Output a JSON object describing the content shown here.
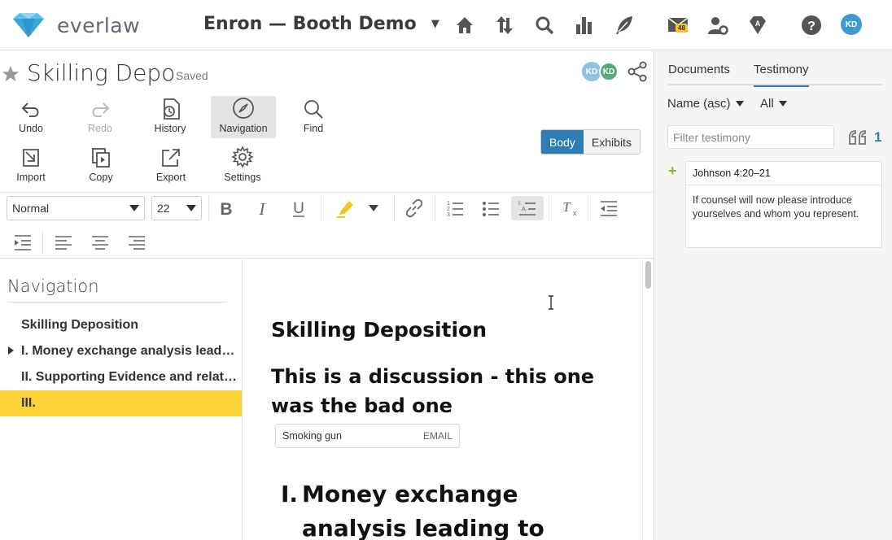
{
  "app": {
    "brand": "everlaw",
    "project": "Enron — Booth Demo"
  },
  "topnav": {
    "icons": [
      "home-icon",
      "updown-arrows-icon",
      "search-icon",
      "bar-chart-icon",
      "feather-pen-icon",
      "mail-icon",
      "user-gear-icon",
      "diamond-badge-icon",
      "help-icon"
    ],
    "mail_count": "48",
    "user_initials": "KD"
  },
  "document": {
    "title": "Skilling Depo",
    "status": "Saved",
    "collab_initials": [
      "KD",
      "KD"
    ]
  },
  "toolbar": {
    "undo": "Undo",
    "redo": "Redo",
    "history": "History",
    "navigation": "Navigation",
    "find": "Find",
    "import": "Import",
    "copy": "Copy",
    "export": "Export",
    "settings": "Settings"
  },
  "view_toggle": {
    "body": "Body",
    "exhibits": "Exhibits",
    "selected": "Body"
  },
  "format": {
    "style": "Normal",
    "size": "22"
  },
  "navigation": {
    "heading": "Navigation",
    "items": [
      {
        "label": "Skilling Deposition",
        "expandable": false,
        "selected": false
      },
      {
        "label": "I. Money exchange analysis leading to",
        "expandable": true,
        "selected": false
      },
      {
        "label": "II. Supporting Evidence and related",
        "expandable": false,
        "selected": false
      },
      {
        "label": "III.",
        "expandable": false,
        "selected": true
      }
    ]
  },
  "body": {
    "title": "Skilling Deposition",
    "heading2_line1": "This is a discussion - this one",
    "heading2_line2": "was the bad one",
    "tag_label": "Smoking gun",
    "tag_type": "EMAIL",
    "heading3_num": "I.",
    "heading3_line1": "Money exchange",
    "heading3_line2": "analysis leading to"
  },
  "right_panel": {
    "tabs": [
      "Documents",
      "Testimony"
    ],
    "active_tab": "Testimony",
    "sort": "Name (asc)",
    "filter_scope": "All",
    "filter_placeholder": "Filter testimony",
    "count": "1",
    "cards": [
      {
        "cite": "Johnson 4:20–21",
        "text": "If counsel will now please introduce yourselves and whom you represent."
      }
    ]
  },
  "colors": {
    "accent": "#2c7eb5",
    "highlight": "#fdd33a",
    "add_green": "#8cb832"
  }
}
